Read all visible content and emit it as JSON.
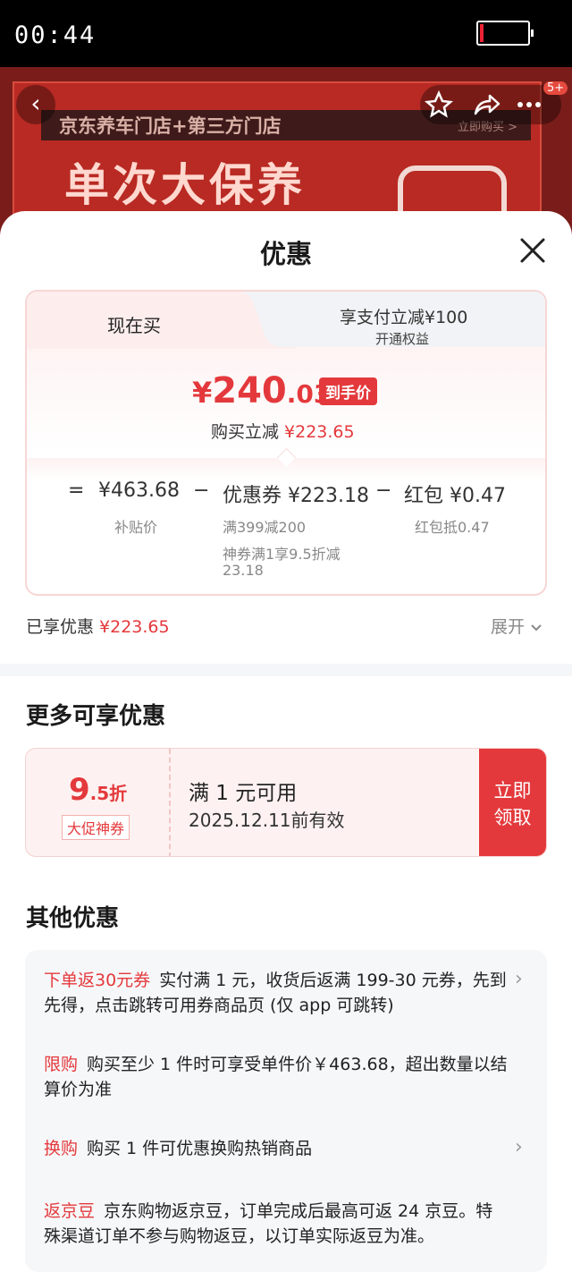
{
  "status_bar": {
    "time": "00:44"
  },
  "hero": {
    "banner_text": "京东养车门店+第三方门店",
    "buy_now": "立即购买 >",
    "big_title": "单次大保养",
    "badge": "5+"
  },
  "sheet": {
    "title": "优惠",
    "tabs": {
      "now": "现在买",
      "pay_discount": "享支付立减¥100",
      "pay_discount_sub": "开通权益"
    },
    "price": {
      "currency": "¥",
      "integer": "240",
      "decimal": ".03",
      "tag": "到手价",
      "reduce_label": "购买立减",
      "reduce_value": "¥223.65"
    },
    "breakdown": {
      "eq": "=",
      "subsidy_price": "¥463.68",
      "subsidy_label": "补贴价",
      "minus1": "−",
      "coupon_label": "优惠券 ¥223.18",
      "coupon_note1": "满399减200",
      "coupon_note2": "神券满1享9.5折减",
      "coupon_note3": "23.18",
      "minus2": "−",
      "redpacket_label": "红包 ¥0.47",
      "redpacket_note": "红包抵0.47"
    },
    "enjoyed": {
      "label": "已享优惠",
      "value": "¥223.65",
      "expand": "展开"
    },
    "more_title": "更多可享优惠",
    "coupon": {
      "discount_num": "9",
      "discount_rest": ".5折",
      "tag": "大促神券",
      "condition": "满 1 元可用",
      "valid": "2025.12.11前有效",
      "claim_line1": "立即",
      "claim_line2": "领取"
    },
    "other_title": "其他优惠",
    "promos": [
      {
        "label": "下单返30元券",
        "text": "实付满 1 元，收货后返满 199-30 元券，先到先得，点击跳转可用券商品页 (仅 app 可跳转)"
      },
      {
        "label": "限购",
        "text": "购买至少 1 件时可享受单件价￥463.68，超出数量以结算价为准"
      },
      {
        "label": "换购",
        "text": "购买 1 件可优惠换购热销商品"
      },
      {
        "label": "返京豆",
        "text": "京东购物返京豆，订单完成后最高可返 24 京豆。特殊渠道订单不参与购物返豆，以订单实际返豆为准。"
      }
    ]
  },
  "colors": {
    "accent": "#e4393c",
    "hero_bg": "#b82a23"
  }
}
